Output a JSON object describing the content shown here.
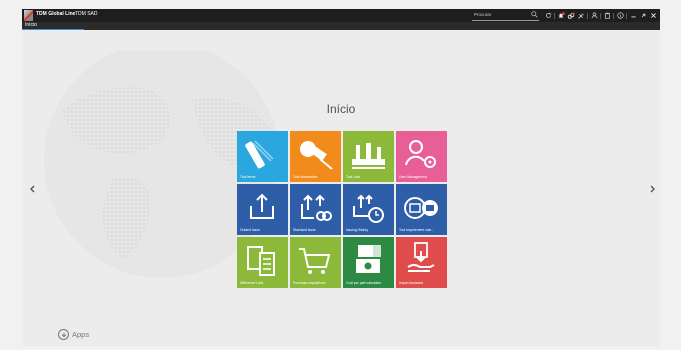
{
  "titlebar": {
    "app_title": "TDM Global Line",
    "user_name": "TDM SAD",
    "search_placeholder": "Procurar"
  },
  "subbar": {
    "tab_label": "Início"
  },
  "main": {
    "title": "Início",
    "apps_label": "Apps"
  },
  "tiles": [
    {
      "label": "Tool Items",
      "color": "#29a7de"
    },
    {
      "label": "Tool Assemblies",
      "color": "#f08b1c"
    },
    {
      "label": "Tool Lists",
      "color": "#8db93b"
    },
    {
      "label": "User Management",
      "color": "#e85f98"
    },
    {
      "label": "Guided Issue",
      "color": "#2e5ea8"
    },
    {
      "label": "Standard Issue",
      "color": "#2e5ea8"
    },
    {
      "label": "Issuing History",
      "color": "#2e5ea8"
    },
    {
      "label": "Tool requirement calc...",
      "color": "#2e5ea8"
    },
    {
      "label": "Difference Lists",
      "color": "#8db93b"
    },
    {
      "label": "Purchase requisitions",
      "color": "#8db93b"
    },
    {
      "label": "Cost per part calculator",
      "color": "#2c8a42"
    },
    {
      "label": "Import Assistant",
      "color": "#e04b4b"
    }
  ]
}
